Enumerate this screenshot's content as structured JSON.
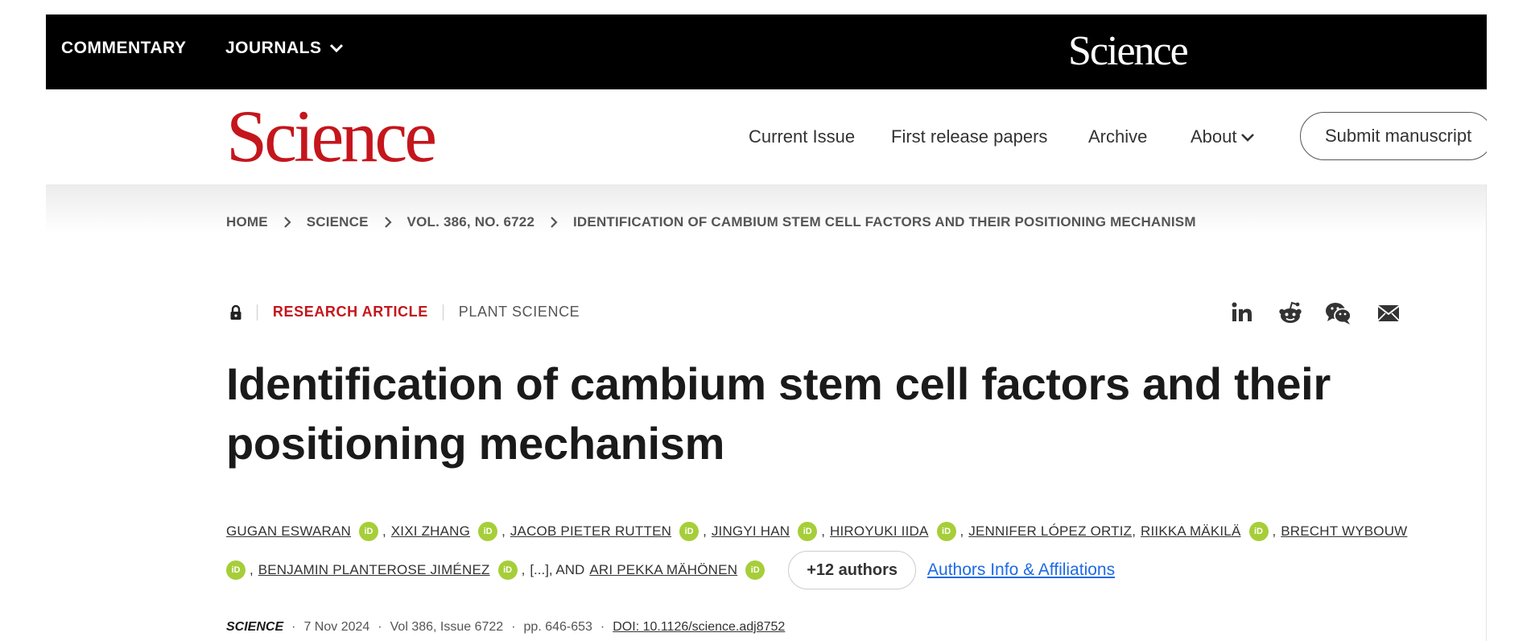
{
  "topbar": {
    "commentary": "COMMENTARY",
    "journals": "JOURNALS",
    "logo": "Science"
  },
  "header": {
    "logo": "Science",
    "nav": [
      "Current Issue",
      "First release papers",
      "Archive",
      "About"
    ],
    "submit": "Submit manuscript"
  },
  "breadcrumb": [
    "HOME",
    "SCIENCE",
    "VOL. 386, NO. 6722",
    "IDENTIFICATION OF CAMBIUM STEM CELL FACTORS AND THEIR POSITIONING MECHANISM"
  ],
  "article": {
    "type": "RESEARCH ARTICLE",
    "subject": "PLANT SCIENCE",
    "title_line1": "Identification of cambium stem cell factors and their",
    "title_line2": "positioning mechanism"
  },
  "share_icons": [
    "linkedin-icon",
    "reddit-icon",
    "wechat-icon",
    "email-icon"
  ],
  "orcid_label": "iD",
  "authors": {
    "list": [
      "GUGAN ESWARAN",
      "XIXI ZHANG",
      "JACOB PIETER RUTTEN",
      "JINGYI HAN",
      "HIROYUKI IIDA",
      "JENNIFER LÓPEZ ORTIZ",
      "RIIKKA MÄKILÄ",
      "BRECHT WYBOUW",
      "BENJAMIN PLANTEROSE JIMÉNEZ",
      "ARI PEKKA MÄHÖNEN"
    ],
    "ellipsis": "[...], AND",
    "more_button": "+12 authors",
    "affiliations_link": "Authors Info & Affiliations"
  },
  "citation": {
    "journal": "SCIENCE",
    "date": "7 Nov 2024",
    "volume": "Vol 386, Issue 6722",
    "pages": "pp. 646-653",
    "doi": "DOI: 10.1126/science.adj8752"
  },
  "colors": {
    "brand_red": "#c4161c",
    "orcid_green": "#a6ce39",
    "link_blue": "#1d6ae5",
    "topbar_bg": "#000000"
  }
}
